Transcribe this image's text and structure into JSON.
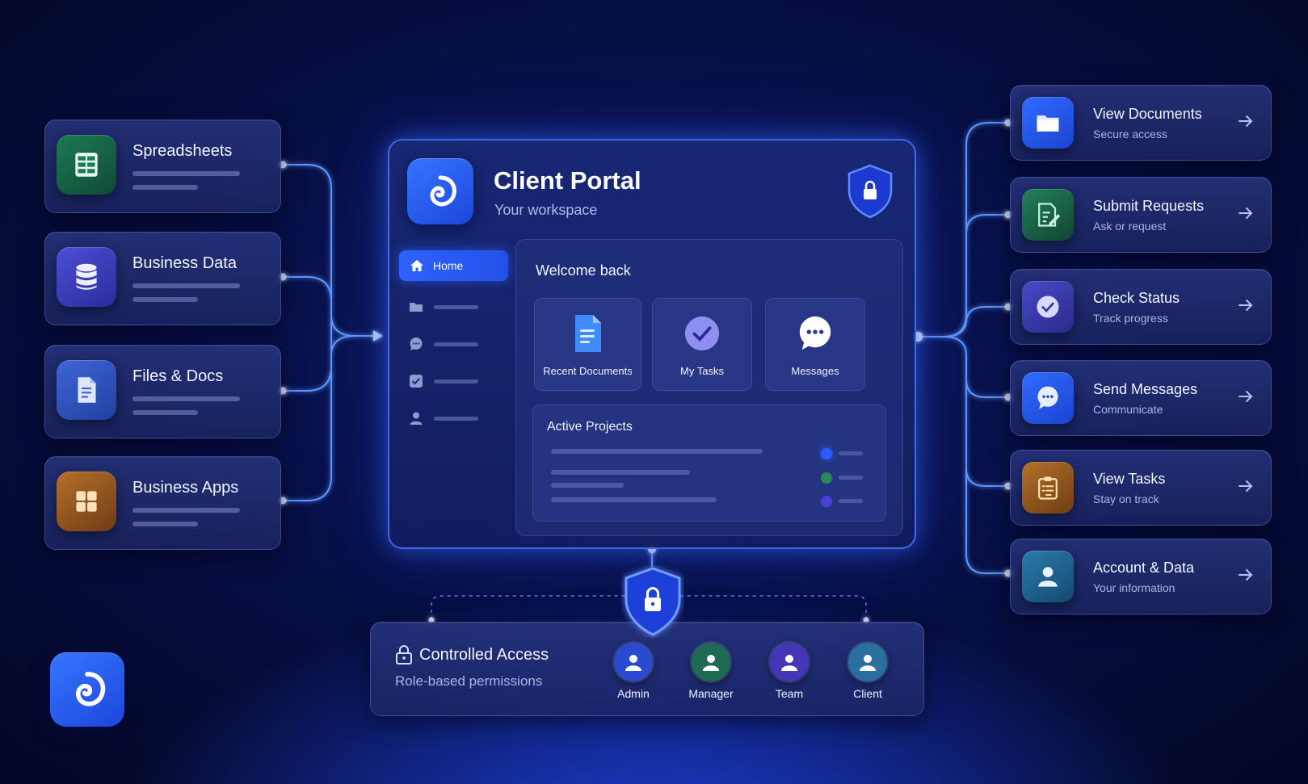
{
  "sources": [
    {
      "title": "Spreadsheets",
      "icon": "spreadsheet-icon",
      "color": "#1e7a55"
    },
    {
      "title": "Business Data",
      "icon": "database-icon",
      "color": "#4c4fd8"
    },
    {
      "title": "Files & Docs",
      "icon": "document-icon",
      "color": "#3e66d8"
    },
    {
      "title": "Business Apps",
      "icon": "apps-grid-icon",
      "color": "#b5702a"
    }
  ],
  "portal": {
    "title": "Client Portal",
    "subtitle": "Your workspace",
    "nav": {
      "home_label": "Home",
      "items": [
        "folder-icon",
        "chat-icon",
        "checkbox-icon",
        "user-icon"
      ]
    },
    "welcome": "Welcome back",
    "quick_tiles": [
      {
        "label": "Recent Documents",
        "icon": "document-icon"
      },
      {
        "label": "My Tasks",
        "icon": "check-circle-icon"
      },
      {
        "label": "Messages",
        "icon": "chat-bubble-icon"
      }
    ],
    "projects": {
      "title": "Active Projects",
      "status_colors": [
        "#2e5bff",
        "#2a8a5a",
        "#4a3fd6"
      ]
    }
  },
  "destinations": [
    {
      "title": "View Documents",
      "subtitle": "Secure access",
      "icon": "folder-icon",
      "color": "#2f6cff"
    },
    {
      "title": "Submit Requests",
      "subtitle": "Ask or request",
      "icon": "edit-form-icon",
      "color": "#23805a"
    },
    {
      "title": "Check Status",
      "subtitle": "Track progress",
      "icon": "check-circle-icon",
      "color": "#4a48c8"
    },
    {
      "title": "Send Messages",
      "subtitle": "Communicate",
      "icon": "chat-bubble-icon",
      "color": "#2f6cff"
    },
    {
      "title": "View Tasks",
      "subtitle": "Stay on track",
      "icon": "clipboard-icon",
      "color": "#b5702a"
    },
    {
      "title": "Account & Data",
      "subtitle": "Your information",
      "icon": "user-icon",
      "color": "#2b7cae"
    }
  ],
  "access": {
    "title": "Controlled Access",
    "subtitle": "Role-based permissions",
    "roles": [
      {
        "label": "Admin",
        "color": "#2a4ad0"
      },
      {
        "label": "Manager",
        "color": "#1f6a52"
      },
      {
        "label": "Team",
        "color": "#4536b8"
      },
      {
        "label": "Client",
        "color": "#2b6fa0"
      }
    ]
  },
  "colors": {
    "accent": "#2f62ff",
    "glow": "#4f8bff",
    "background": "#07104a"
  }
}
